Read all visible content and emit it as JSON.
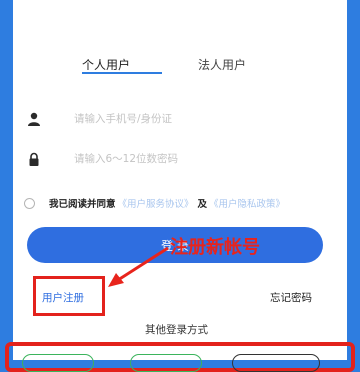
{
  "tabs": {
    "personal": "个人用户",
    "legal": "法人用户"
  },
  "form": {
    "phone_placeholder": "请输入手机号/身份证",
    "password_placeholder": "请输入6～12位数密码"
  },
  "agreement": {
    "text": "我已阅读并同意",
    "service_link": "《用户服务协议》",
    "and": "及",
    "privacy_link": "《用户隐私政策》"
  },
  "login_button": "登 录",
  "annotation": {
    "text": "注册新帐号",
    "color": "#e8241c"
  },
  "links": {
    "register": "用户注册",
    "forgot": "忘记密码"
  },
  "other_login": {
    "title": "其他登录方式"
  },
  "colors": {
    "brand_blue": "#2f6ee0",
    "background": "#2e7de0",
    "highlight_red": "#e3221c"
  },
  "icons": {
    "user": "user-icon",
    "lock": "lock-icon"
  }
}
